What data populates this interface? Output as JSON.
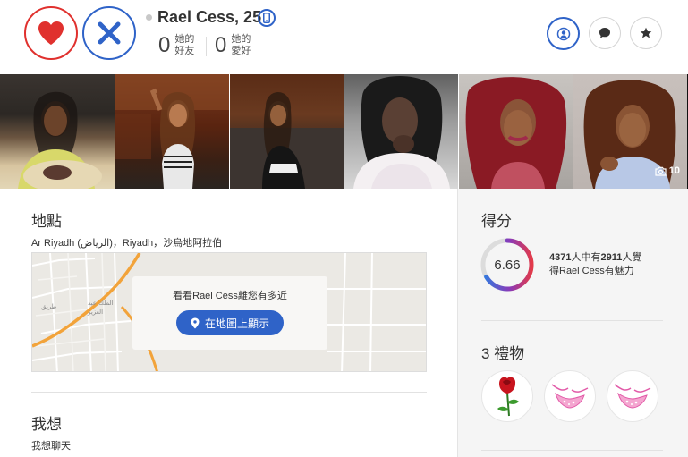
{
  "profile": {
    "name": "Rael Cess, 25",
    "stats": [
      {
        "value": "0",
        "label_line1": "她的",
        "label_line2": "好友"
      },
      {
        "value": "0",
        "label_line1": "她的",
        "label_line2": "愛好"
      }
    ]
  },
  "photos": {
    "count": "10"
  },
  "location": {
    "title": "地點",
    "text": "Ar Riyadh (الرياض)，Riyadh，沙烏地阿拉伯",
    "map_prompt": "看看Rael Cess離您有多近",
    "map_button": "在地圖上顯示"
  },
  "want": {
    "title": "我想",
    "text": "我想聊天"
  },
  "score": {
    "title": "得分",
    "value": "6.66",
    "line1_total": "4371",
    "line1_mid": "人中有",
    "line1_count": "2911",
    "line1_end": "人覺",
    "line2": "得Rael Cess有魅力",
    "fraction": 0.666
  },
  "gifts": {
    "title": "3 禮物"
  },
  "colors": {
    "like": "#e0312e",
    "pass": "#2f63c8",
    "accent": "#2f63c8"
  }
}
